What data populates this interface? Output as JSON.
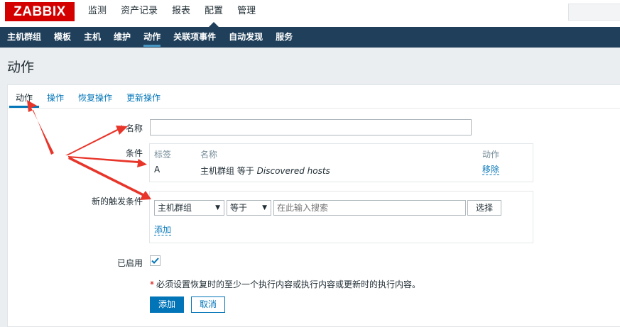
{
  "logo": "ZABBIX",
  "main_menu": [
    "监测",
    "资产记录",
    "报表",
    "配置",
    "管理"
  ],
  "sub_menu": [
    "主机群组",
    "模板",
    "主机",
    "维护",
    "动作",
    "关联项事件",
    "自动发现",
    "服务"
  ],
  "page_title": "动作",
  "tabs": [
    "动作",
    "操作",
    "恢复操作",
    "更新操作"
  ],
  "form": {
    "name_label": "名称",
    "name_value": "",
    "conditions_label": "条件",
    "conditions_headers": {
      "tag": "标签",
      "name": "名称",
      "action": "动作"
    },
    "conditions_rows": [
      {
        "tag": "A",
        "name_prefix": "主机群组 等于 ",
        "name_value": "Discovered hosts",
        "action": "移除"
      }
    ],
    "new_condition_label": "新的触发条件",
    "new_condition_type": "主机群组",
    "new_condition_operator": "等于",
    "search_placeholder": "在此输入搜索",
    "select_button": "选择",
    "add_link": "添加",
    "enabled_label": "已启用",
    "enabled_checked": true,
    "note": "必须设置恢复时的至少一个执行内容或执行内容或更新时的执行内容。",
    "add_button": "添加",
    "cancel_button": "取消"
  },
  "colors": {
    "accent": "#0275b8",
    "header": "#1f3f5a",
    "logo": "#d40000",
    "annotation_arrow": "#e8352a"
  }
}
